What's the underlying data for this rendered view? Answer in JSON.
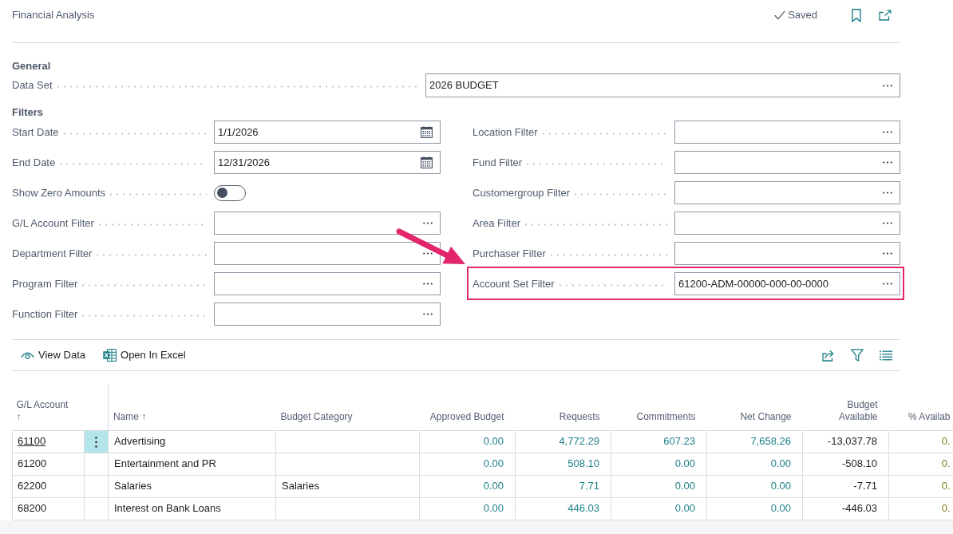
{
  "header": {
    "title": "Financial Analysis",
    "status": "Saved"
  },
  "general": {
    "heading": "General",
    "fields": [
      {
        "label": "Data Set",
        "kind": "lookup",
        "value": "2026 BUDGET"
      }
    ]
  },
  "filters": {
    "heading": "Filters",
    "left": [
      {
        "label": "Start Date",
        "kind": "date",
        "value": "1/1/2026"
      },
      {
        "label": "End Date",
        "kind": "date",
        "value": "12/31/2026"
      },
      {
        "label": "Show Zero Amounts",
        "kind": "toggle",
        "on": false
      },
      {
        "label": "G/L Account Filter",
        "kind": "lookup"
      },
      {
        "label": "Department Filter",
        "kind": "lookup"
      },
      {
        "label": "Program Filter",
        "kind": "lookup"
      },
      {
        "label": "Function Filter",
        "kind": "lookup"
      }
    ],
    "right": [
      {
        "label": "Location Filter",
        "kind": "lookup",
        "highlighted": false
      },
      {
        "label": "Fund Filter",
        "kind": "lookup",
        "highlighted": false
      },
      {
        "label": "Customergroup Filter",
        "kind": "lookup",
        "highlighted": false
      },
      {
        "label": "Area Filter",
        "kind": "lookup",
        "highlighted": false
      },
      {
        "label": "Purchaser Filter",
        "kind": "lookup",
        "highlighted": false
      },
      {
        "label": "Account Set Filter",
        "kind": "lookup",
        "value": "61200-ADM-00000-000-00-0000",
        "highlighted": true
      }
    ]
  },
  "actions": [
    {
      "label": "View Data",
      "kind": "view"
    },
    {
      "label": "Open In Excel",
      "kind": "excel"
    }
  ],
  "table": {
    "columns": [
      {
        "label": "G/L Account ↑",
        "kind": "code"
      },
      {
        "kind": "menu"
      },
      {
        "label": "Name ↑",
        "kind": "text"
      },
      {
        "label": "Budget Category",
        "kind": "text"
      },
      {
        "label": "Approved Budget",
        "kind": "drilldown"
      },
      {
        "label": "Requests",
        "kind": "drilldown"
      },
      {
        "label": "Commitments",
        "kind": "drilldown"
      },
      {
        "label": "Net Change",
        "kind": "drilldown"
      },
      {
        "label": "Budget Available",
        "kind": "amount"
      },
      {
        "label": "% Availab",
        "kind": "percent"
      }
    ],
    "rows": [
      {
        "selected": true,
        "gl_account": "61100",
        "name": "Advertising",
        "approved_budget": "0.00",
        "requests": "4,772.29",
        "commitments": "607.23",
        "net_change": "7,658.26",
        "budget_available": "-13,037.78",
        "pct_available": "0."
      },
      {
        "selected": false,
        "gl_account": "61200",
        "name": "Entertainment and PR",
        "approved_budget": "0.00",
        "requests": "508.10",
        "commitments": "0.00",
        "net_change": "0.00",
        "budget_available": "-508.10",
        "pct_available": "0."
      },
      {
        "selected": false,
        "gl_account": "62200",
        "name": "Salaries",
        "budget_category": "Salaries",
        "approved_budget": "0.00",
        "requests": "7.71",
        "commitments": "0.00",
        "net_change": "0.00",
        "budget_available": "-7.71",
        "pct_available": "0."
      },
      {
        "selected": false,
        "gl_account": "68200",
        "name": "Interest on Bank Loans",
        "approved_budget": "0.00",
        "requests": "446.03",
        "commitments": "0.00",
        "net_change": "0.00",
        "budget_available": "-446.03",
        "pct_available": "0."
      }
    ]
  }
}
